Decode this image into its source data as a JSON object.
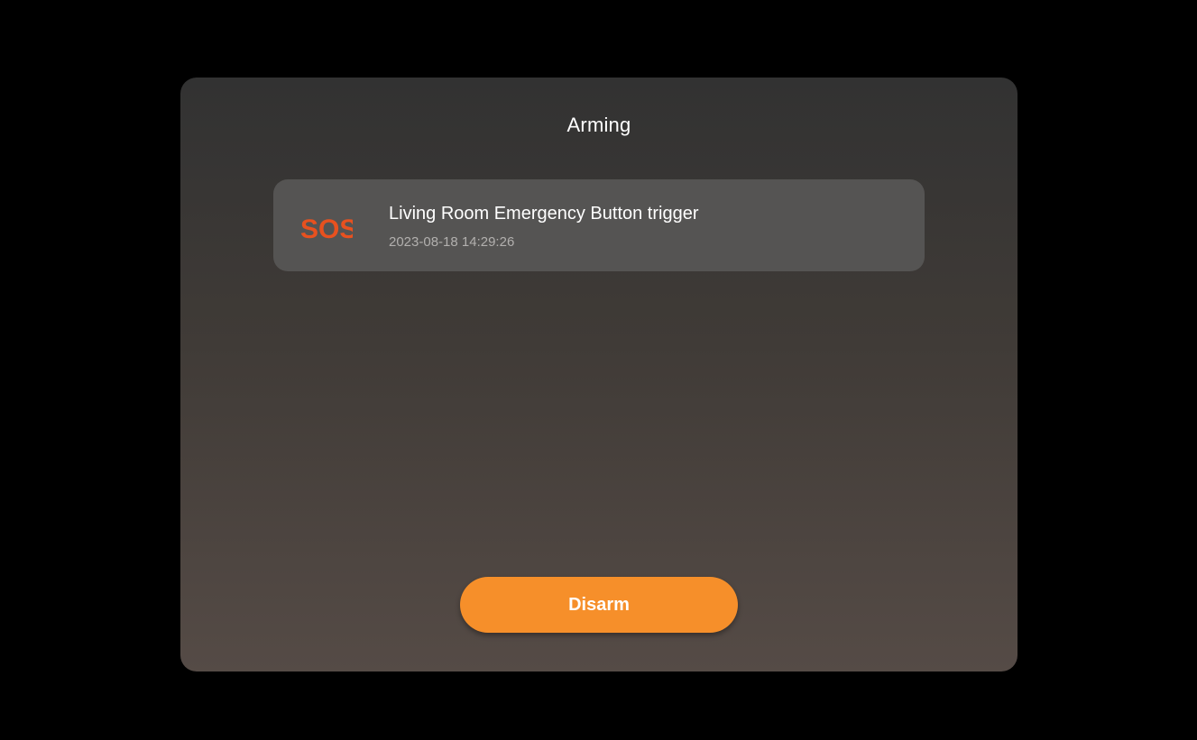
{
  "dialog": {
    "title": "Arming"
  },
  "alert": {
    "icon": "sos-icon",
    "icon_text": "SOS",
    "icon_color": "#e8511f",
    "title": "Living Room Emergency Button trigger",
    "timestamp": "2023-08-18 14:29:26"
  },
  "actions": {
    "disarm_label": "Disarm",
    "disarm_color": "#f68f2a"
  }
}
